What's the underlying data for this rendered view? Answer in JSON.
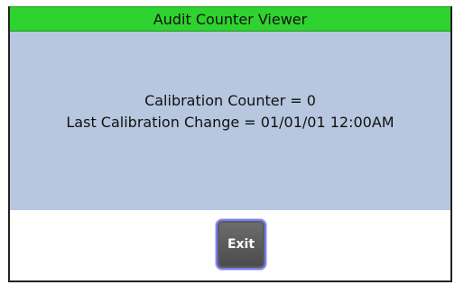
{
  "window": {
    "title": "Audit Counter Viewer"
  },
  "info": {
    "calibration_counter": "Calibration Counter = 0",
    "last_calibration_change": "Last Calibration Change = 01/01/01 12:00AM"
  },
  "footer": {
    "exit_label": "Exit"
  },
  "colors": {
    "titlebar": "#2fd32f",
    "panel": "#b7c7df",
    "button": "#5a5a5a",
    "button_border": "#7a7df0"
  }
}
